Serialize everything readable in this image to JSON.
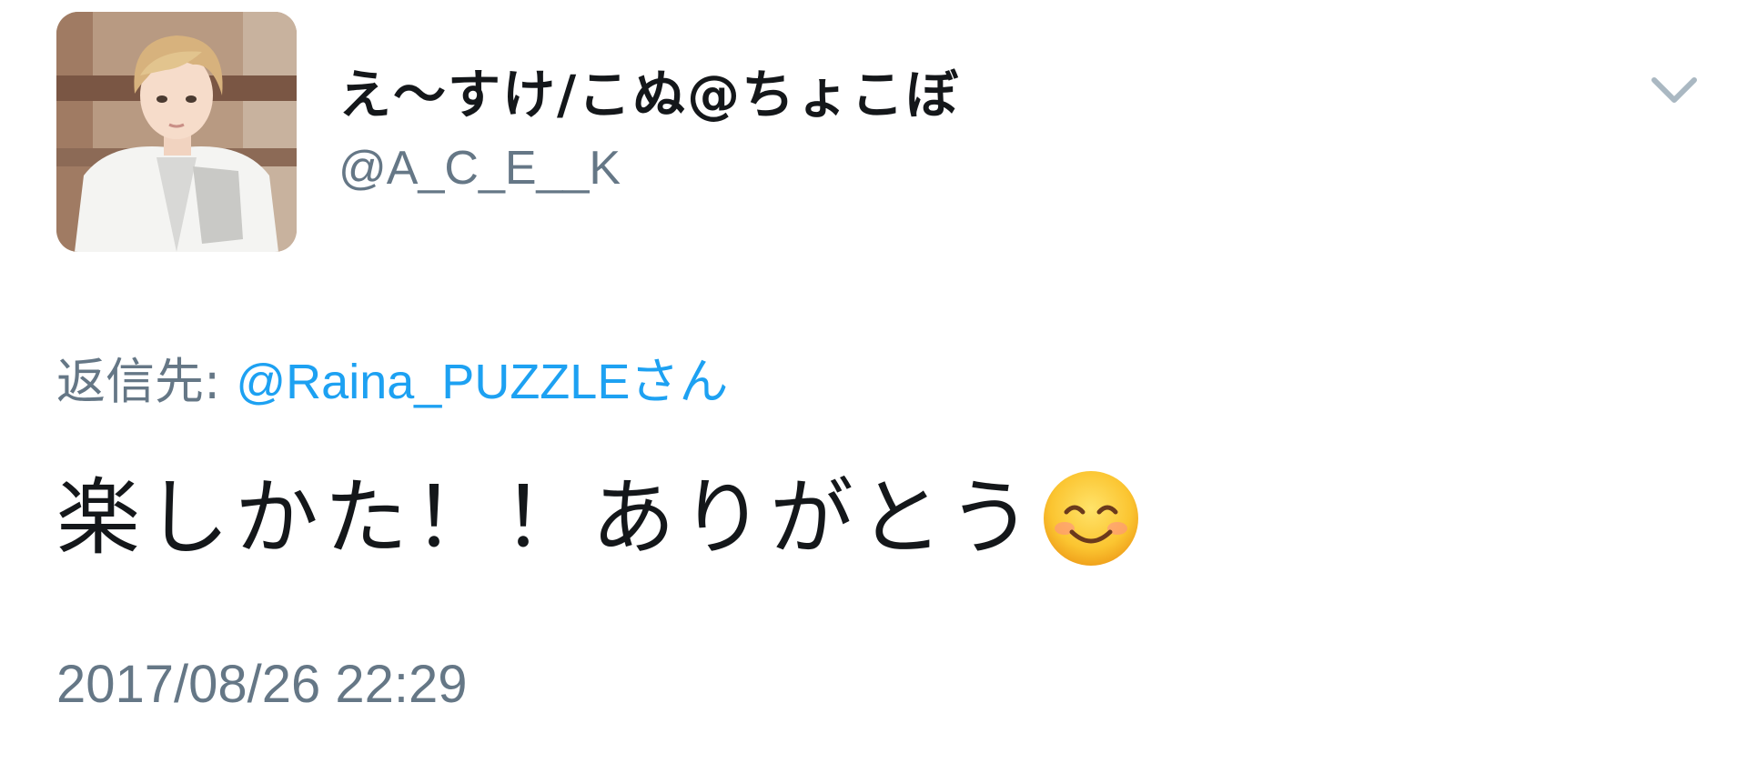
{
  "tweet": {
    "author": {
      "display_name": "え〜すけ/こぬ@ちょこぼ",
      "handle": "@A_C_E__K",
      "avatar_icon": "user-avatar-photo"
    },
    "menu_icon": "chevron-down-icon",
    "reply_to": {
      "prefix": "返信先: ",
      "mention": "@Raina_PUZZLE",
      "suffix": "さん"
    },
    "text": "楽しかた！！ありがとう",
    "emoji": "smiling-face-icon",
    "timestamp": "2017/08/26 22:29"
  },
  "colors": {
    "text_primary": "#14171a",
    "text_secondary": "#657786",
    "link": "#1da1f2",
    "chevron": "#aab8c2",
    "background": "#ffffff"
  }
}
